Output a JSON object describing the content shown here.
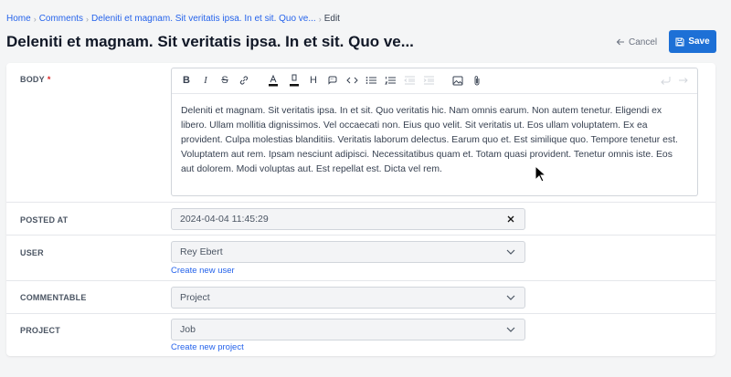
{
  "breadcrumb": {
    "items": [
      "Home",
      "Comments",
      "Deleniti et magnam. Sit veritatis ipsa. In et sit. Quo ve..."
    ],
    "current": "Edit",
    "separator": "›"
  },
  "page": {
    "title": "Deleniti et magnam. Sit veritatis ipsa. In et sit. Quo ve..."
  },
  "actions": {
    "cancel_label": "Cancel",
    "save_label": "Save"
  },
  "form": {
    "body": {
      "label": "BODY",
      "required_marker": "*",
      "content": "Deleniti et magnam. Sit veritatis ipsa. In et sit. Quo veritatis hic. Nam omnis earum. Non autem tenetur. Eligendi ex libero. Ullam mollitia dignissimos. Vel occaecati non. Eius quo velit. Sit veritatis ut. Eos ullam voluptatem. Ex ea provident. Culpa molestias blanditiis. Veritatis laborum delectus. Earum quo et. Est similique quo. Tempore tenetur est. Voluptatem aut rem. Ipsam nesciunt adipisci. Necessitatibus quam et. Totam quasi provident. Tenetur omnis iste. Eos aut dolorem. Modi voluptas aut. Est repellat est. Dicta vel rem."
    },
    "posted_at": {
      "label": "POSTED AT",
      "value": "2024-04-04 11:45:29"
    },
    "user": {
      "label": "USER",
      "value": "Rey Ebert",
      "create_link": "Create new user"
    },
    "commentable": {
      "label": "COMMENTABLE",
      "value": "Project"
    },
    "project": {
      "label": "PROJECT",
      "value": "Job",
      "create_link": "Create new project"
    }
  },
  "toolbar_icons": [
    "bold-icon",
    "italic-icon",
    "strikethrough-icon",
    "link-icon",
    "text-color-icon",
    "highlight-icon",
    "heading-icon",
    "quote-icon",
    "code-icon",
    "bullet-list-icon",
    "numbered-list-icon",
    "outdent-icon",
    "indent-icon",
    "image-icon",
    "attachment-icon",
    "undo-icon",
    "redo-icon"
  ],
  "colors": {
    "accent": "#1d70d6",
    "link": "#2563eb",
    "required": "#dc2626"
  }
}
